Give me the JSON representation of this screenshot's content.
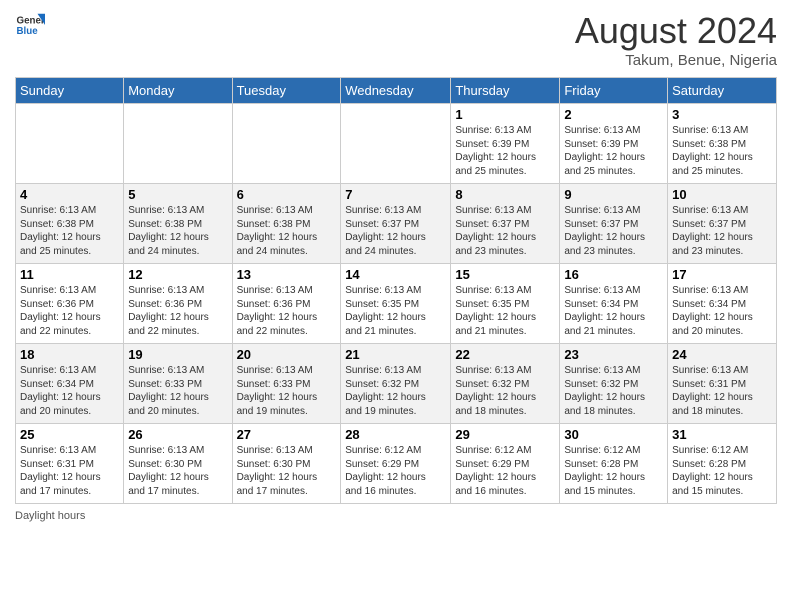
{
  "header": {
    "logo_general": "General",
    "logo_blue": "Blue",
    "title": "August 2024",
    "subtitle": "Takum, Benue, Nigeria"
  },
  "days_of_week": [
    "Sunday",
    "Monday",
    "Tuesday",
    "Wednesday",
    "Thursday",
    "Friday",
    "Saturday"
  ],
  "footer": "Daylight hours",
  "weeks": [
    [
      {
        "day": "",
        "info": ""
      },
      {
        "day": "",
        "info": ""
      },
      {
        "day": "",
        "info": ""
      },
      {
        "day": "",
        "info": ""
      },
      {
        "day": "1",
        "info": "Sunrise: 6:13 AM\nSunset: 6:39 PM\nDaylight: 12 hours\nand 25 minutes."
      },
      {
        "day": "2",
        "info": "Sunrise: 6:13 AM\nSunset: 6:39 PM\nDaylight: 12 hours\nand 25 minutes."
      },
      {
        "day": "3",
        "info": "Sunrise: 6:13 AM\nSunset: 6:38 PM\nDaylight: 12 hours\nand 25 minutes."
      }
    ],
    [
      {
        "day": "4",
        "info": "Sunrise: 6:13 AM\nSunset: 6:38 PM\nDaylight: 12 hours\nand 25 minutes."
      },
      {
        "day": "5",
        "info": "Sunrise: 6:13 AM\nSunset: 6:38 PM\nDaylight: 12 hours\nand 24 minutes."
      },
      {
        "day": "6",
        "info": "Sunrise: 6:13 AM\nSunset: 6:38 PM\nDaylight: 12 hours\nand 24 minutes."
      },
      {
        "day": "7",
        "info": "Sunrise: 6:13 AM\nSunset: 6:37 PM\nDaylight: 12 hours\nand 24 minutes."
      },
      {
        "day": "8",
        "info": "Sunrise: 6:13 AM\nSunset: 6:37 PM\nDaylight: 12 hours\nand 23 minutes."
      },
      {
        "day": "9",
        "info": "Sunrise: 6:13 AM\nSunset: 6:37 PM\nDaylight: 12 hours\nand 23 minutes."
      },
      {
        "day": "10",
        "info": "Sunrise: 6:13 AM\nSunset: 6:37 PM\nDaylight: 12 hours\nand 23 minutes."
      }
    ],
    [
      {
        "day": "11",
        "info": "Sunrise: 6:13 AM\nSunset: 6:36 PM\nDaylight: 12 hours\nand 22 minutes."
      },
      {
        "day": "12",
        "info": "Sunrise: 6:13 AM\nSunset: 6:36 PM\nDaylight: 12 hours\nand 22 minutes."
      },
      {
        "day": "13",
        "info": "Sunrise: 6:13 AM\nSunset: 6:36 PM\nDaylight: 12 hours\nand 22 minutes."
      },
      {
        "day": "14",
        "info": "Sunrise: 6:13 AM\nSunset: 6:35 PM\nDaylight: 12 hours\nand 21 minutes."
      },
      {
        "day": "15",
        "info": "Sunrise: 6:13 AM\nSunset: 6:35 PM\nDaylight: 12 hours\nand 21 minutes."
      },
      {
        "day": "16",
        "info": "Sunrise: 6:13 AM\nSunset: 6:34 PM\nDaylight: 12 hours\nand 21 minutes."
      },
      {
        "day": "17",
        "info": "Sunrise: 6:13 AM\nSunset: 6:34 PM\nDaylight: 12 hours\nand 20 minutes."
      }
    ],
    [
      {
        "day": "18",
        "info": "Sunrise: 6:13 AM\nSunset: 6:34 PM\nDaylight: 12 hours\nand 20 minutes."
      },
      {
        "day": "19",
        "info": "Sunrise: 6:13 AM\nSunset: 6:33 PM\nDaylight: 12 hours\nand 20 minutes."
      },
      {
        "day": "20",
        "info": "Sunrise: 6:13 AM\nSunset: 6:33 PM\nDaylight: 12 hours\nand 19 minutes."
      },
      {
        "day": "21",
        "info": "Sunrise: 6:13 AM\nSunset: 6:32 PM\nDaylight: 12 hours\nand 19 minutes."
      },
      {
        "day": "22",
        "info": "Sunrise: 6:13 AM\nSunset: 6:32 PM\nDaylight: 12 hours\nand 18 minutes."
      },
      {
        "day": "23",
        "info": "Sunrise: 6:13 AM\nSunset: 6:32 PM\nDaylight: 12 hours\nand 18 minutes."
      },
      {
        "day": "24",
        "info": "Sunrise: 6:13 AM\nSunset: 6:31 PM\nDaylight: 12 hours\nand 18 minutes."
      }
    ],
    [
      {
        "day": "25",
        "info": "Sunrise: 6:13 AM\nSunset: 6:31 PM\nDaylight: 12 hours\nand 17 minutes."
      },
      {
        "day": "26",
        "info": "Sunrise: 6:13 AM\nSunset: 6:30 PM\nDaylight: 12 hours\nand 17 minutes."
      },
      {
        "day": "27",
        "info": "Sunrise: 6:13 AM\nSunset: 6:30 PM\nDaylight: 12 hours\nand 17 minutes."
      },
      {
        "day": "28",
        "info": "Sunrise: 6:12 AM\nSunset: 6:29 PM\nDaylight: 12 hours\nand 16 minutes."
      },
      {
        "day": "29",
        "info": "Sunrise: 6:12 AM\nSunset: 6:29 PM\nDaylight: 12 hours\nand 16 minutes."
      },
      {
        "day": "30",
        "info": "Sunrise: 6:12 AM\nSunset: 6:28 PM\nDaylight: 12 hours\nand 15 minutes."
      },
      {
        "day": "31",
        "info": "Sunrise: 6:12 AM\nSunset: 6:28 PM\nDaylight: 12 hours\nand 15 minutes."
      }
    ]
  ]
}
